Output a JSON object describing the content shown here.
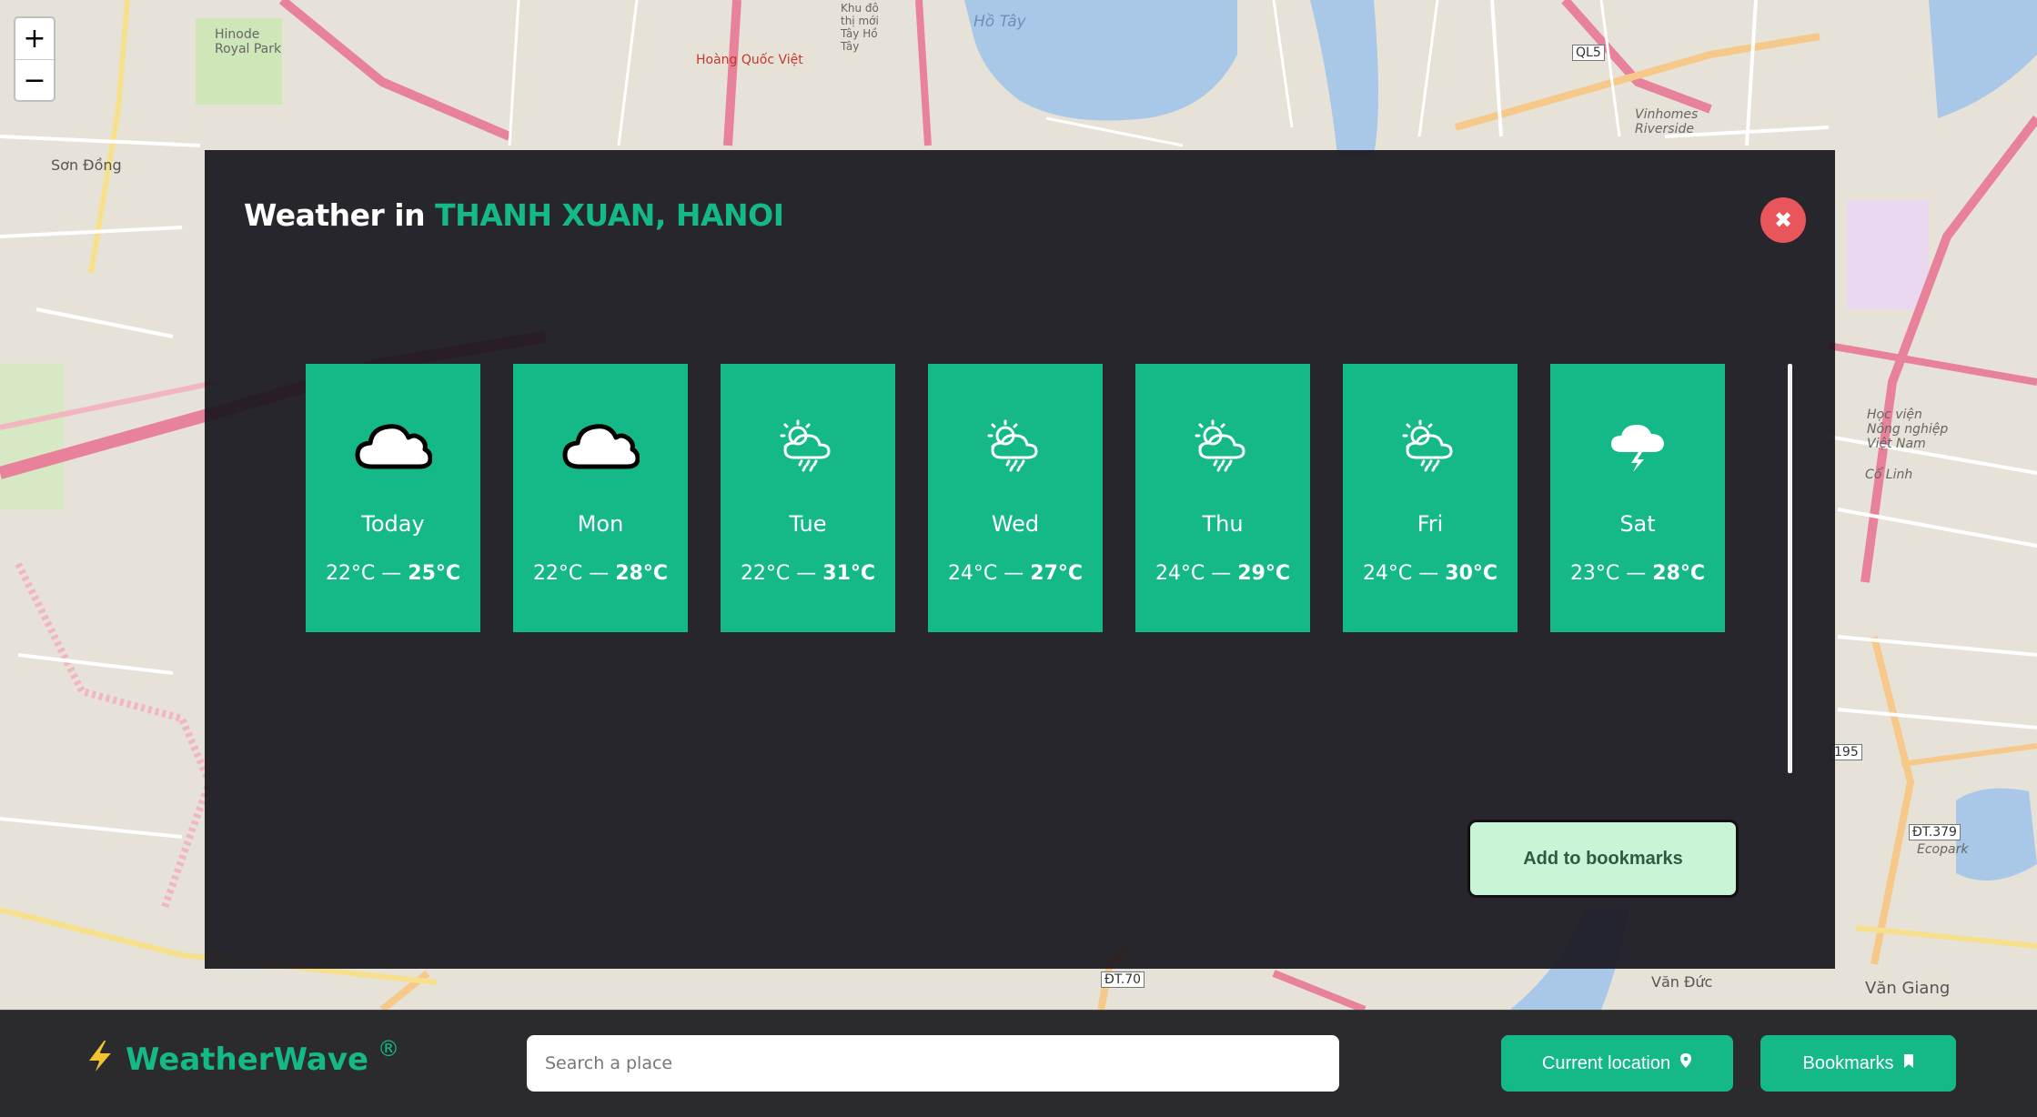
{
  "map": {
    "zoom_in": "+",
    "zoom_out": "−",
    "labels": {
      "hinode": "Hinode\nRoyal Park",
      "son_dong": "Sơn Đồng",
      "ho_tay": "Hồ Tây",
      "ql5": "QL5",
      "vinhomes": "Vinhomes\nRiverside",
      "hoc_vien": "Học viện\nNông nghiệp\nViệt Nam",
      "co_linh": "Cổ Linh",
      "dt379": "ĐT.379",
      "ecopark": "Ecopark",
      "van_giang": "Văn Giang",
      "van_duc": "Văn Đức",
      "dt70": "ĐT.70",
      "r195": "195",
      "hoang_quoc_viet": "Hoàng Quốc Việt",
      "khu_do_thi": "Khu đô\nthị mới\nTây Hồ\nTây"
    }
  },
  "modal": {
    "title_prefix": "Weather in ",
    "place": "THANH XUAN, HANOI",
    "close_symbol": "✖",
    "add_bookmark_label": "Add to bookmarks",
    "forecast": [
      {
        "day": "Today",
        "icon": "cloud-icon",
        "low": "22°C",
        "sep": " — ",
        "high": "25°C"
      },
      {
        "day": "Mon",
        "icon": "cloud-icon",
        "low": "22°C",
        "sep": " — ",
        "high": "28°C"
      },
      {
        "day": "Tue",
        "icon": "sun-cloud-rain-icon",
        "low": "22°C",
        "sep": " — ",
        "high": "31°C"
      },
      {
        "day": "Wed",
        "icon": "sun-cloud-rain-icon",
        "low": "24°C",
        "sep": " — ",
        "high": "27°C"
      },
      {
        "day": "Thu",
        "icon": "sun-cloud-rain-icon",
        "low": "24°C",
        "sep": " — ",
        "high": "29°C"
      },
      {
        "day": "Fri",
        "icon": "sun-cloud-rain-icon",
        "low": "24°C",
        "sep": " — ",
        "high": "30°C"
      },
      {
        "day": "Sat",
        "icon": "cloud-lightning-icon",
        "low": "23°C",
        "sep": " — ",
        "high": "28°C"
      }
    ]
  },
  "bottombar": {
    "brand_name": "WeatherWave",
    "brand_reg": "®",
    "search_placeholder": "Search a place",
    "current_location_label": "Current location",
    "bookmarks_label": "Bookmarks"
  },
  "colors": {
    "accent": "#14b987",
    "close": "#e8565b",
    "modal_bg": "#18161e",
    "bookmark_btn_bg": "#c9f5d6",
    "bar_bg": "#2b2b2d"
  }
}
